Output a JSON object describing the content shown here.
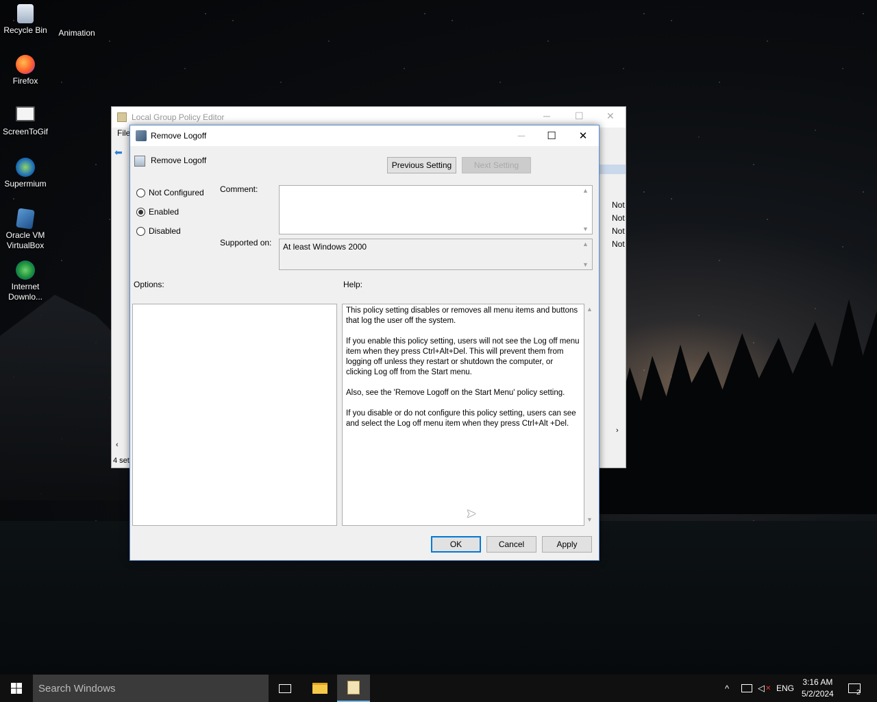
{
  "desktop": {
    "icons": [
      {
        "label": "Recycle Bin"
      },
      {
        "label": "Animation"
      },
      {
        "label": "Firefox"
      },
      {
        "label": "ScreenToGif"
      },
      {
        "label": "Supermium"
      },
      {
        "label": "Oracle VM VirtualBox"
      },
      {
        "label": "Internet Downlo..."
      }
    ]
  },
  "background_window": {
    "title": "Local Group Policy Editor",
    "menu_file": "File",
    "state_rows": [
      "Not",
      "Not",
      "Not",
      "Not"
    ],
    "status": "4 set"
  },
  "dialog": {
    "title": "Remove Logoff",
    "setting_name": "Remove Logoff",
    "previous_button": "Previous Setting",
    "next_button": "Next Setting",
    "radio_not_configured": "Not Configured",
    "radio_enabled": "Enabled",
    "radio_disabled": "Disabled",
    "selected_state": "Enabled",
    "comment_label": "Comment:",
    "comment_value": "",
    "supported_label": "Supported on:",
    "supported_value": "At least Windows 2000",
    "options_label": "Options:",
    "help_label": "Help:",
    "help_text": "This policy setting disables or removes all menu items and buttons that log the user off the system.\n\nIf you enable this policy setting, users will not see the Log off menu item when they press Ctrl+Alt+Del. This will prevent them from logging off unless they restart or shutdown the computer, or clicking Log off from the Start menu.\n\nAlso, see the 'Remove Logoff on the Start Menu' policy setting.\n\nIf you disable or do not configure this policy setting, users can see and select the Log off menu item when they press Ctrl+Alt +Del.",
    "ok_button": "OK",
    "cancel_button": "Cancel",
    "apply_button": "Apply"
  },
  "taskbar": {
    "search_placeholder": "Search Windows",
    "language": "ENG",
    "time": "3:16 AM",
    "date": "5/2/2024",
    "notification_count": "2"
  }
}
